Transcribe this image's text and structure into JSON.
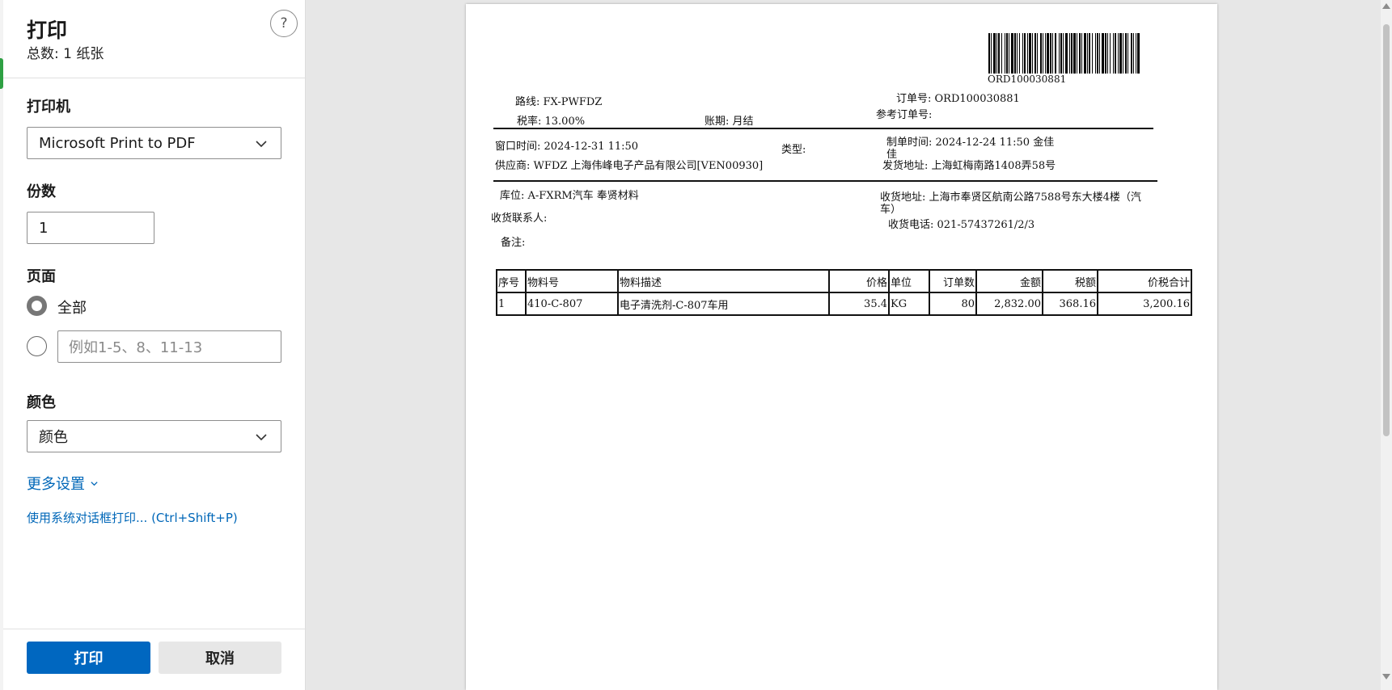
{
  "panel": {
    "title": "打印",
    "subtitle": "总数: 1 纸张",
    "help": "?",
    "printer": {
      "label": "打印机",
      "value": "Microsoft Print to PDF"
    },
    "copies": {
      "label": "份数",
      "value": "1"
    },
    "pages": {
      "label": "页面",
      "all": "全部",
      "range_placeholder": "例如1-5、8、11-13"
    },
    "color": {
      "label": "颜色",
      "value": "颜色"
    },
    "more_settings": "更多设置",
    "system_dialog": "使用系统对话框打印... (Ctrl+Shift+P)",
    "print_button": "打印",
    "cancel_button": "取消"
  },
  "doc": {
    "barcode_text": "ORD100030881",
    "route": "路线: FX-PWFDZ",
    "order_no": "订单号: ORD100030881",
    "tax_rate": "税率: 13.00%",
    "period": "账期: 月结",
    "ref_order": "参考订单号:",
    "window_time": "窗口时间: 2024-12-31 11:50",
    "type": "类型:",
    "created": "制单时间: 2024-12-24 11:50 金佳",
    "created_cont": "佳",
    "supplier": "供应商: WFDZ 上海伟峰电子产品有限公司[VEN00930]",
    "ship_addr": "发货地址: 上海虹梅南路1408弄58号",
    "location": "库位: A-FXRM汽车 奉贤材料",
    "recv_addr": "收货地址: 上海市奉贤区航南公路7588号东大楼4楼（汽",
    "recv_addr_cont": "车）",
    "recv_contact": "收货联系人:",
    "recv_phone": "收货电话: 021-57437261/2/3",
    "remark": "备注:",
    "table": {
      "headers": [
        "序号",
        "物料号",
        "物料描述",
        "价格",
        "单位",
        "订单数",
        "金额",
        "税额",
        "价税合计"
      ],
      "rows": [
        [
          "1",
          "410-C-807",
          "电子清洗剂-C-807车用",
          "35.4",
          "KG",
          "80",
          "2,832.00",
          "368.16",
          "3,200.16"
        ]
      ]
    }
  }
}
